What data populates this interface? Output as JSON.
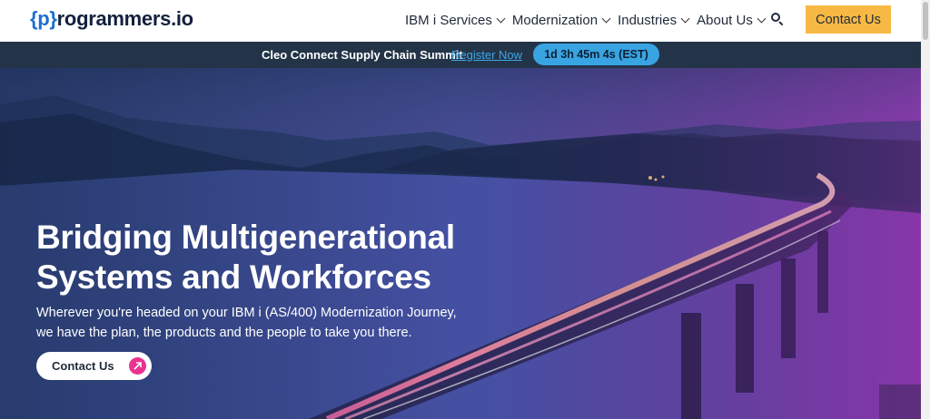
{
  "header": {
    "logo": {
      "brace_open": "{",
      "letter": "p",
      "brace_close": "}",
      "rest": "rogrammers.io"
    },
    "nav": [
      {
        "label": "IBM i Services"
      },
      {
        "label": "Modernization"
      },
      {
        "label": "Industries"
      },
      {
        "label": "About Us"
      }
    ],
    "search_icon": "search-icon",
    "contact_label": "Contact Us"
  },
  "announcement": {
    "text": "Cleo Connect Supply Chain Summit",
    "link": "Register Now",
    "countdown": "1d 3h 45m 4s (EST)"
  },
  "hero": {
    "headline_line1": "Bridging Multigenerational",
    "headline_line2": "Systems and Workforces",
    "sub_line1": "Wherever you're headed on your IBM i (AS/400) Modernization Journey,",
    "sub_line2": "we have the plan, the products and the people to take you there.",
    "cta_label": "Contact Us",
    "cta_icon": "arrow-up-right-icon"
  },
  "colors": {
    "accent_yellow": "#f7b944",
    "announce_bg": "#233448",
    "timer_bg": "#39a4e2",
    "cta_pink": "#e8338f",
    "logo_blue": "#1e6fd0"
  }
}
